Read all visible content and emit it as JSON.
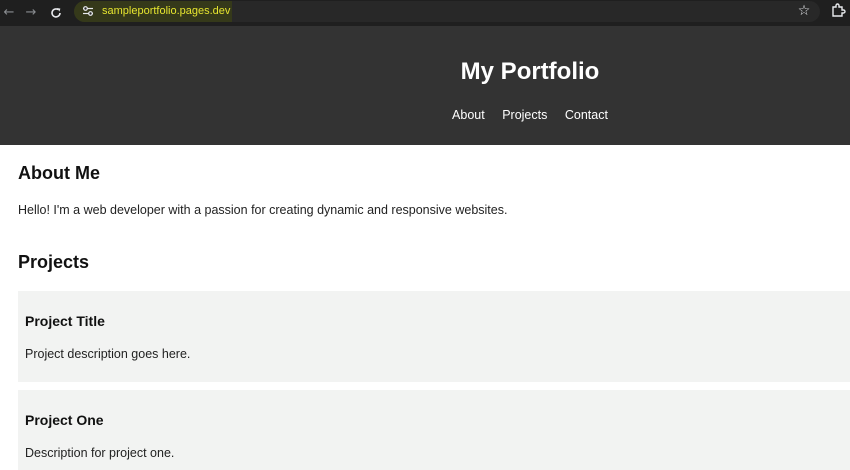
{
  "browser": {
    "url": "sampleportfolio.pages.dev",
    "back_icon": "arrow-left-icon",
    "forward_icon": "arrow-right-icon",
    "reload_icon": "reload-icon",
    "site_info_icon": "tune-icon",
    "bookmark_icon": "star-icon",
    "extensions_icon": "puzzle-icon",
    "url_color": "#e6e52f",
    "chrome_color": "#1f1f1f"
  },
  "header": {
    "title": "My Portfolio",
    "background": "#333333",
    "nav": [
      {
        "label": "About"
      },
      {
        "label": "Projects"
      },
      {
        "label": "Contact"
      }
    ]
  },
  "about": {
    "heading": "About Me",
    "text": "Hello! I'm a web developer with a passion for creating dynamic and responsive websites."
  },
  "projects": {
    "heading": "Projects",
    "card_background": "#f2f3f2",
    "items": [
      {
        "title": "Project Title",
        "description": "Project description goes here."
      },
      {
        "title": "Project One",
        "description": "Description for project one."
      }
    ]
  }
}
